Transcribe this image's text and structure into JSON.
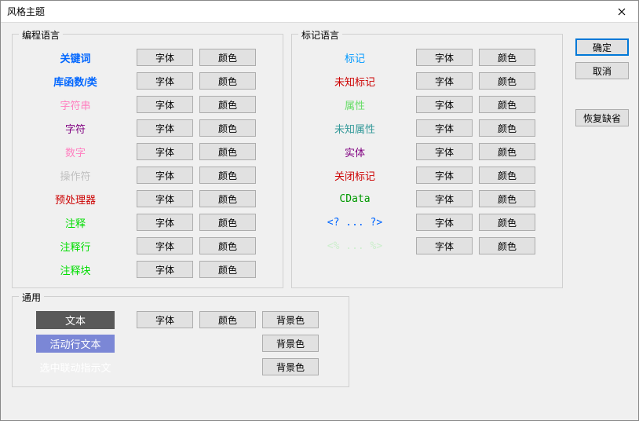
{
  "window": {
    "title": "风格主题"
  },
  "buttons": {
    "ok": "确定",
    "cancel": "取消",
    "restore": "恢复缺省",
    "font": "字体",
    "color": "颜色",
    "bgcolor": "背景色"
  },
  "groups": {
    "programming": {
      "title": "编程语言",
      "items": [
        {
          "label": "关键词",
          "color": "#0066ff",
          "bold": true
        },
        {
          "label": "库函数/类",
          "color": "#0066ff",
          "bold": true
        },
        {
          "label": "字符串",
          "color": "#ff80c0",
          "bold": false
        },
        {
          "label": "字符",
          "color": "#800080",
          "bold": false
        },
        {
          "label": "数字",
          "color": "#ff80c0",
          "bold": false
        },
        {
          "label": "操作符",
          "color": "#c0c0c0",
          "bold": false
        },
        {
          "label": "预处理器",
          "color": "#cc0000",
          "bold": false
        },
        {
          "label": "注释",
          "color": "#00dd00",
          "bold": false
        },
        {
          "label": "注释行",
          "color": "#00dd00",
          "bold": false
        },
        {
          "label": "注释块",
          "color": "#00dd00",
          "bold": false
        }
      ]
    },
    "markup": {
      "title": "标记语言",
      "items": [
        {
          "label": "标记",
          "color": "#0099ff",
          "bold": false
        },
        {
          "label": "未知标记",
          "color": "#cc0000",
          "bold": false
        },
        {
          "label": "属性",
          "color": "#66dd66",
          "bold": false
        },
        {
          "label": "未知属性",
          "color": "#339999",
          "bold": false
        },
        {
          "label": "实体",
          "color": "#800080",
          "bold": false
        },
        {
          "label": "关闭标记",
          "color": "#cc0000",
          "bold": false
        },
        {
          "label": "CData",
          "color": "#009900",
          "bold": false,
          "mono": true
        },
        {
          "label": "<? ... ?>",
          "color": "#0066ff",
          "bold": false,
          "mono": true
        },
        {
          "label": "<% ... %>",
          "color": "#cceecc",
          "bold": false,
          "mono": true
        }
      ]
    },
    "general": {
      "title": "通用",
      "items": [
        {
          "label": "文本",
          "style": "dark",
          "font": true,
          "color": true,
          "bg": true
        },
        {
          "label": "活动行文本",
          "style": "blue",
          "font": false,
          "color": false,
          "bg": true
        },
        {
          "label": "选中联动指示文",
          "style": "white",
          "font": false,
          "color": false,
          "bg": true
        }
      ]
    }
  }
}
